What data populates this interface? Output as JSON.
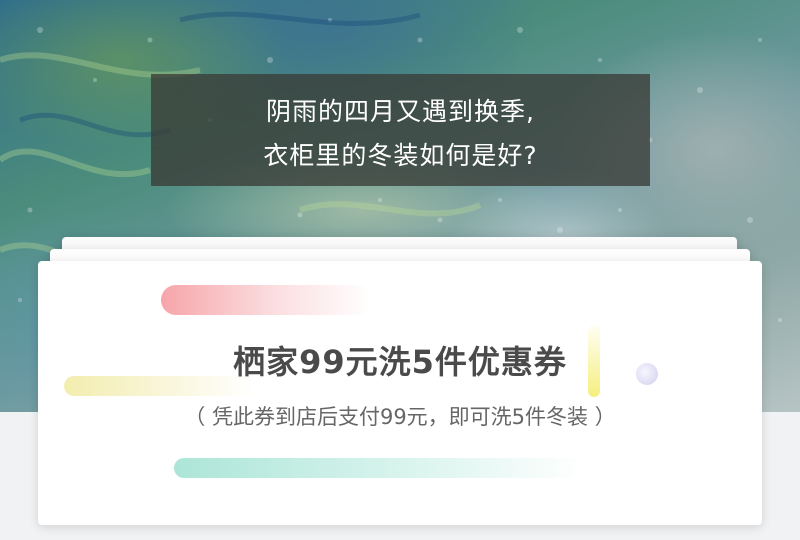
{
  "hero": {
    "line1": "阴雨的四月又遇到换季,",
    "line2": "衣柜里的冬装如何是好?"
  },
  "coupon": {
    "headline": "栖家99元洗5件优惠券",
    "subline": "（ 凭此券到店后支付99元，即可洗5件冬装 ）"
  },
  "colors": {
    "overlay": "#3a3c37",
    "card_bg": "#ffffff",
    "headline_text": "#4a4a4a",
    "accent_pink": "#f6a0a5",
    "accent_yellow": "#f2eca0",
    "accent_mint": "#a8e4d6"
  }
}
